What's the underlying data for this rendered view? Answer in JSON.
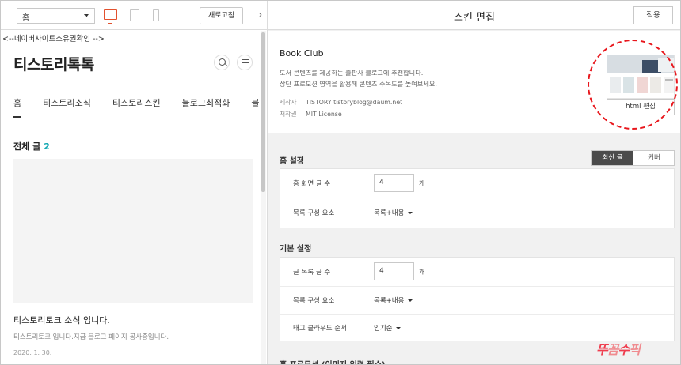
{
  "left_panel": {
    "page_select": "홈",
    "refresh_label": "새로고침",
    "collapse_glyph": "›",
    "html_comment": "<--네이버사이트소유권확인 -->",
    "blog_title": "티스토리톡톡",
    "nav": [
      "홈",
      "티스토리소식",
      "티스토리스킨",
      "블로그최적화",
      "블"
    ],
    "all_posts": {
      "label": "전체 글",
      "count": "2"
    },
    "post": {
      "title": "티스토리토크 소식 입니다.",
      "excerpt": "티스토리토크 입니다.지금 블로그 페이지 공사중입니다.",
      "date": "2020. 1. 30."
    }
  },
  "right_panel": {
    "title": "스킨 편집",
    "apply_label": "적용",
    "skin": {
      "name": "Book Club",
      "desc_line1": "도서 콘텐츠를 제공하는 출판사 블로그에 추천합니다.",
      "desc_line2": "상단 프로모션 영역을 활용해 콘텐츠 주목도를 높여보세요.",
      "author_key": "제작자",
      "author_value": "TISTORY tistoryblog@daum.net",
      "license_key": "저작권",
      "license_value": "MIT License",
      "html_edit_label": "html 편집"
    },
    "home_settings": {
      "title": "홈 설정",
      "toggle_on": "최신 글",
      "toggle_off": "커버",
      "rows": [
        {
          "label": "홈 화면 글 수",
          "value": "4",
          "unit": "개"
        },
        {
          "label": "목록 구성 요소",
          "value": "목록+내용"
        }
      ]
    },
    "basic_settings": {
      "title": "기본 설정",
      "rows": [
        {
          "label": "글 목록 글 수",
          "value": "4",
          "unit": "개"
        },
        {
          "label": "목록 구성 요소",
          "value": "목록+내용"
        },
        {
          "label": "태그 클라우드 순서",
          "value": "인기순"
        }
      ]
    },
    "next_section_title": "홈 프로모션 (이미지 입력 필수)"
  },
  "watermark": {
    "part1": "뚜",
    "part2": "꼼",
    "part3": "수",
    "part4": "픽"
  },
  "colors": {
    "accent_red": "#e8161c",
    "count_teal": "#11a7b1",
    "toggle_dark": "#4b4b4b"
  }
}
